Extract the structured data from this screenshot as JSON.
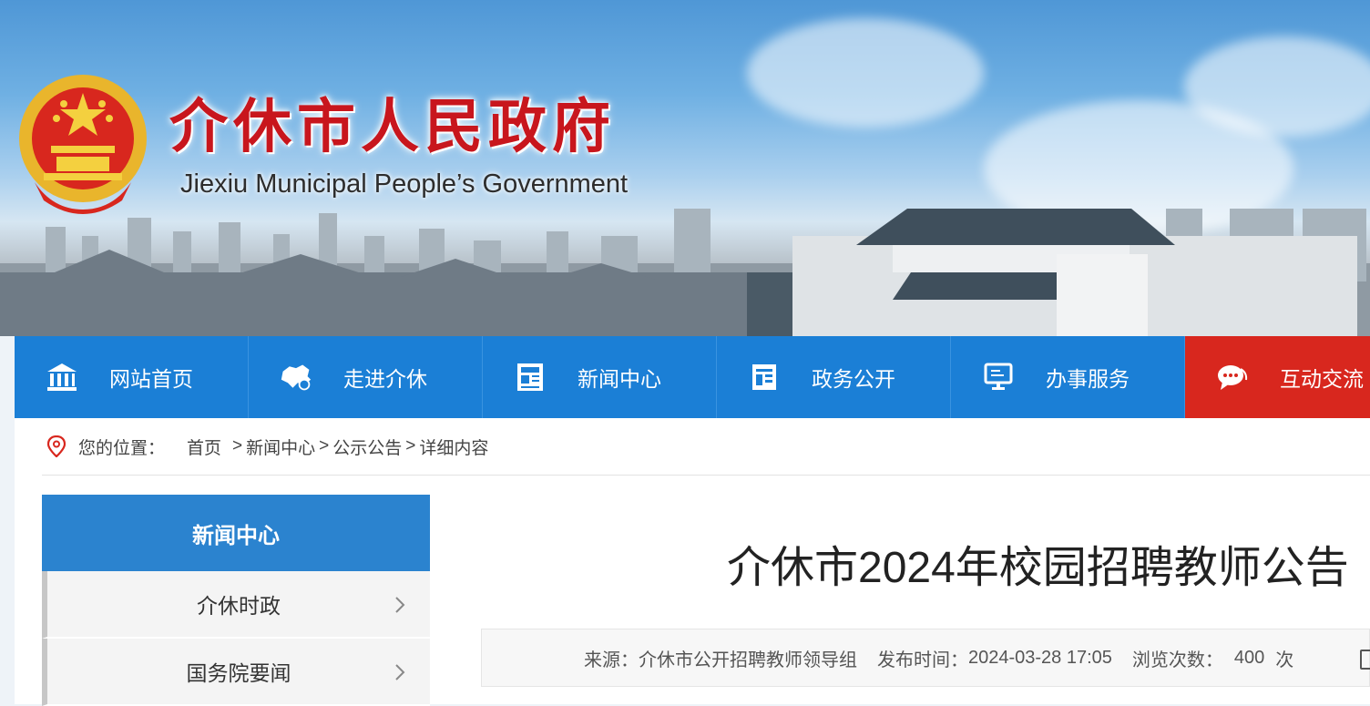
{
  "header": {
    "title_cn": "介休市人民政府",
    "title_en": "Jiexiu Municipal People’s Government"
  },
  "nav": {
    "items": [
      {
        "label": "网站首页",
        "icon": "building-icon"
      },
      {
        "label": "走进介休",
        "icon": "map-icon"
      },
      {
        "label": "新闻中心",
        "icon": "newspaper-icon"
      },
      {
        "label": "政务公开",
        "icon": "document-icon"
      },
      {
        "label": "办事服务",
        "icon": "monitor-icon"
      },
      {
        "label": "互动交流",
        "icon": "chat-icon"
      }
    ]
  },
  "breadcrumb": {
    "label": "您的位置：",
    "items": [
      "首页",
      "新闻中心",
      "公示公告",
      "详细内容"
    ],
    "separator": ">"
  },
  "sidebar": {
    "heading": "新闻中心",
    "items": [
      "介休时政",
      "国务院要闻"
    ]
  },
  "article": {
    "title": "介休市2024年校园招聘教师公告",
    "source_label": "来源：",
    "source": "介休市公开招聘教师领导组",
    "date_label": "发布时间：",
    "date": "2024-03-28 17:05",
    "views_label": "浏览次数：",
    "views": "400",
    "views_unit": "次"
  },
  "colors": {
    "nav_blue": "#1b7fd6",
    "nav_active_red": "#d8271e",
    "sidebar_head": "#2b83cf",
    "title_red": "#c8161d"
  }
}
